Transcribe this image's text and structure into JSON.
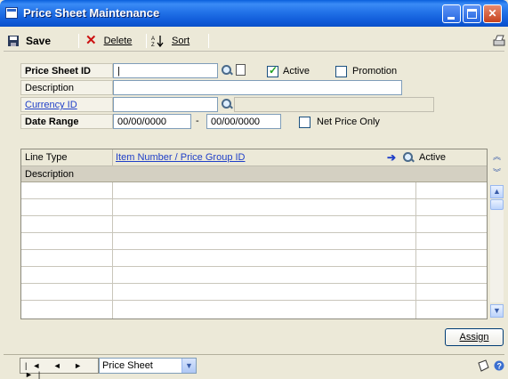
{
  "window": {
    "title": "Price Sheet Maintenance"
  },
  "toolbar": {
    "save": "Save",
    "delete": "Delete",
    "sort": "Sort"
  },
  "form": {
    "price_sheet_id_label": "Price Sheet ID",
    "price_sheet_id_value": "|",
    "active_label": "Active",
    "active_checked": true,
    "promotion_label": "Promotion",
    "promotion_checked": false,
    "description_label": "Description",
    "description_value": "",
    "currency_id_label": "Currency ID",
    "currency_id_value": "",
    "date_range_label": "Date Range",
    "date_from": "00/00/0000",
    "date_separator": "-",
    "date_to": "00/00/0000",
    "net_price_only_label": "Net Price Only",
    "net_price_only_checked": false
  },
  "grid": {
    "col_line_type": "Line Type",
    "col_item_number": "Item Number / Price Group ID",
    "col_active": "Active",
    "col_description": "Description",
    "empty_rows": 8
  },
  "buttons": {
    "assign": "Assign"
  },
  "statusbar": {
    "nav": "|◄ ◄ ► ►|",
    "view_selected": "Price Sheet"
  },
  "icons": [
    "window-icon",
    "save-icon",
    "delete-icon",
    "sort-icon",
    "print-icon",
    "lookup-icon",
    "new-page-icon",
    "arrow-right-icon",
    "collapse-icon",
    "expand-icon",
    "scroll-up-icon",
    "scroll-down-icon",
    "note-icon",
    "help-icon",
    "dropdown-icon"
  ]
}
